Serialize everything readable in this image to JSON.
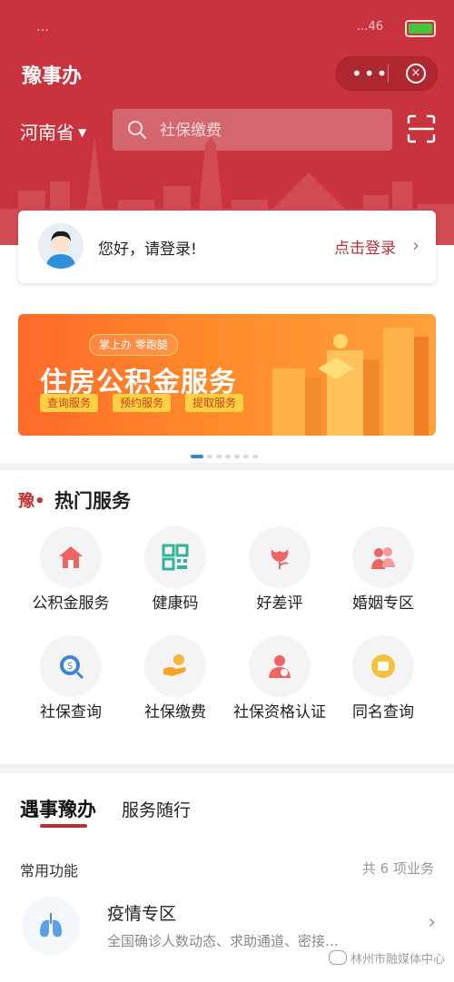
{
  "status_bar": {
    "carrier": "…",
    "signal": "…46",
    "battery_color": "#45c53d"
  },
  "header": {
    "app_title": "豫事办",
    "more_label": "•••",
    "close_symbol": "×",
    "province": "河南省",
    "search_placeholder": "社保缴费",
    "brand_color": "#c9333d"
  },
  "login": {
    "greeting": "您好，请登录!",
    "link": "点击登录",
    "arrow": "›"
  },
  "banner": {
    "top_pill": "掌上办 零跑腿",
    "headline": "住房公积金服务",
    "tags": [
      "查询服务",
      "预约服务",
      "提取服务"
    ]
  },
  "hot_services": {
    "logo": "豫•",
    "title": "热门服务",
    "items": [
      {
        "label": "公积金服务",
        "icon": "house-icon"
      },
      {
        "label": "健康码",
        "icon": "qr-code-icon"
      },
      {
        "label": "好差评",
        "icon": "flower-icon"
      },
      {
        "label": "婚姻专区",
        "icon": "couple-icon"
      },
      {
        "label": "社保查询",
        "icon": "social-security-search-icon"
      },
      {
        "label": "社保缴费",
        "icon": "payment-hand-icon"
      },
      {
        "label": "社保资格认证",
        "icon": "person-verify-icon"
      },
      {
        "label": "同名查询",
        "icon": "name-search-icon"
      }
    ]
  },
  "tabs": {
    "active": "遇事豫办",
    "inactive": "服务随行"
  },
  "common": {
    "title": "常用功能",
    "count": "共 6 项业务",
    "items": [
      {
        "title": "疫情专区",
        "desc": "全国确诊人数动态、求助通道、密接…",
        "icon": "lungs-icon"
      }
    ]
  },
  "watermark": "林州市融媒体中心"
}
